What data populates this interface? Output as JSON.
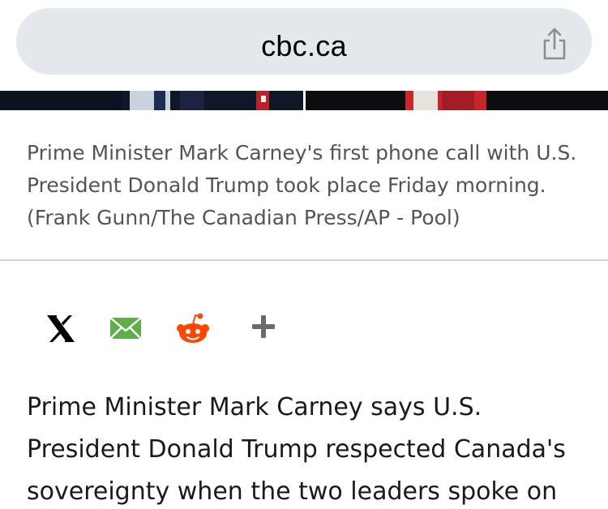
{
  "browser": {
    "url": "cbc.ca",
    "share_icon": "share-icon"
  },
  "photo": {
    "caption": "Prime Minister Mark Carney's first phone call with U.S. President Donald Trump took place Friday morning. (Frank Gunn/The Canadian Press/AP - Pool)"
  },
  "share_bar": {
    "items": [
      {
        "icon": "x-icon",
        "color": "#000000"
      },
      {
        "icon": "email-icon",
        "color": "#5fae4b"
      },
      {
        "icon": "reddit-icon",
        "color": "#ff4500"
      },
      {
        "icon": "plus-icon",
        "color": "#6b6b6b"
      }
    ]
  },
  "article": {
    "body": "Prime Minister Mark Carney says U.S. President Donald Trump respected Canada's sovereignty when the two leaders spoke on"
  }
}
